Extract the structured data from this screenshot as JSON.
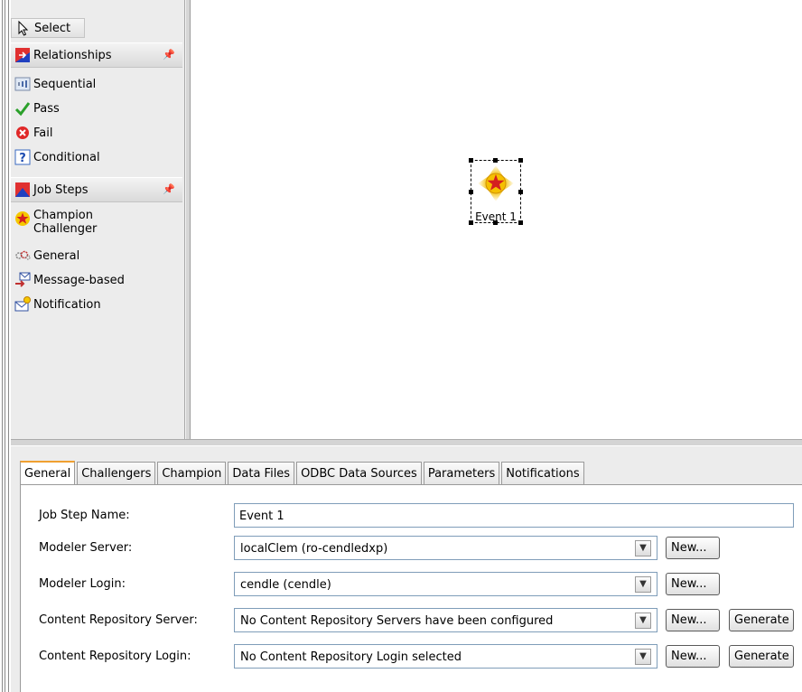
{
  "palette": {
    "select": "Select",
    "relationships_drawer": "Relationships",
    "relationships": [
      {
        "label": "Sequential",
        "icon": "sequential-icon"
      },
      {
        "label": "Pass",
        "icon": "pass-check-icon"
      },
      {
        "label": "Fail",
        "icon": "fail-x-icon"
      },
      {
        "label": "Conditional",
        "icon": "conditional-question-icon"
      }
    ],
    "jobsteps_drawer": "Job Steps",
    "jobsteps": [
      {
        "label_line1": "Champion",
        "label_line2": "Challenger",
        "icon": "champion-challenger-star-icon"
      },
      {
        "label": "General",
        "icon": "general-gear-icon"
      },
      {
        "label": "Message-based",
        "icon": "message-based-icon"
      },
      {
        "label": "Notification",
        "icon": "notification-envelope-icon"
      }
    ]
  },
  "canvas": {
    "node_label": "Event 1"
  },
  "tabs": [
    "General",
    "Challengers",
    "Champion",
    "Data Files",
    "ODBC Data Sources",
    "Parameters",
    "Notifications"
  ],
  "active_tab": "General",
  "form": {
    "job_step_name_label": "Job Step Name:",
    "job_step_name_value": "Event 1",
    "modeler_server_label": "Modeler Server:",
    "modeler_server_value": "localClem (ro-cendledxp)",
    "modeler_login_label": "Modeler Login:",
    "modeler_login_value": "cendle (cendle)",
    "cr_server_label": "Content Repository Server:",
    "cr_server_value": "No Content Repository Servers have been configured",
    "cr_login_label": "Content Repository Login:",
    "cr_login_value": "No Content Repository Login selected",
    "new_label": "New...",
    "generate_label": "Generate"
  },
  "colors": {
    "active_tab_accent": "#f0a030",
    "field_border": "#7f9db9",
    "star_red": "#d42020",
    "star_glow": "#f5c800"
  }
}
